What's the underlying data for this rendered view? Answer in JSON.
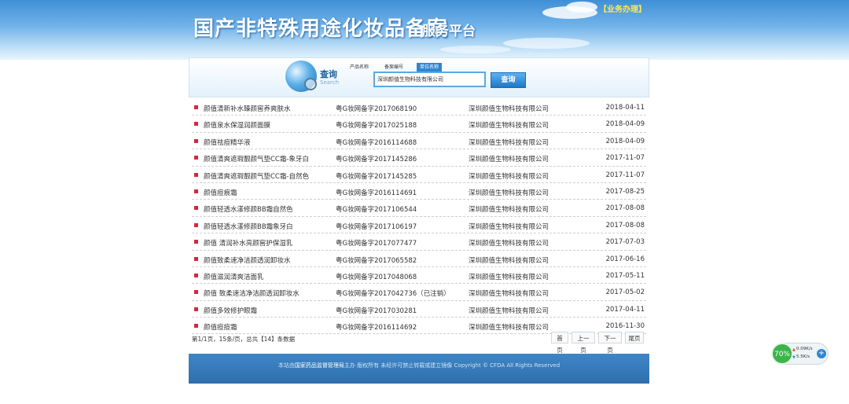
{
  "header": {
    "title": "国产非特殊用途化妆品备案",
    "subtitle": "服务平台",
    "service_link": "【业务办理】"
  },
  "search": {
    "label": "查询",
    "label_en": "Search",
    "tabs": [
      {
        "label": "产品名称",
        "active": false
      },
      {
        "label": "备案编号",
        "active": false
      },
      {
        "label": "单位名称",
        "active": true
      }
    ],
    "value": "深圳颜值生物科技有限公司",
    "button": "查询"
  },
  "rows": [
    {
      "name": "颜值清新补水臻颜窖养爽肤水",
      "reg": "粤G妆网备字2017068190",
      "company": "深圳颜值生物科技有限公司",
      "date": "2018-04-11"
    },
    {
      "name": "颜值泉水保湿润颜面膜",
      "reg": "粤G妆网备字2017025188",
      "company": "深圳颜值生物科技有限公司",
      "date": "2018-04-09"
    },
    {
      "name": "颜值祛痘精华液",
      "reg": "粤G妆网备字2016114688",
      "company": "深圳颜值生物科技有限公司",
      "date": "2018-04-09"
    },
    {
      "name": "颜值清爽遮瑕靓颜气垫CC霜-象牙白",
      "reg": "粤G妆网备字2017145286",
      "company": "深圳颜值生物科技有限公司",
      "date": "2017-11-07"
    },
    {
      "name": "颜值清爽遮瑕靓颜气垫CC霜-自然色",
      "reg": "粤G妆网备字2017145285",
      "company": "深圳颜值生物科技有限公司",
      "date": "2017-11-07"
    },
    {
      "name": "颜值痘痕霜",
      "reg": "粤G妆网备字2016114691",
      "company": "深圳颜值生物科技有限公司",
      "date": "2017-08-25"
    },
    {
      "name": "颜值轻透水漾修颜BB霜自然色",
      "reg": "粤G妆网备字2017106544",
      "company": "深圳颜值生物科技有限公司",
      "date": "2017-08-08"
    },
    {
      "name": "颜值轻透水漾修颜BB霜象牙白",
      "reg": "粤G妆网备字2017106197",
      "company": "深圳颜值生物科技有限公司",
      "date": "2017-08-08"
    },
    {
      "name": "颜值 清润补水亮颜窖护保湿乳",
      "reg": "粤G妆网备字2017077477",
      "company": "深圳颜值生物科技有限公司",
      "date": "2017-07-03"
    },
    {
      "name": "颜值致柔速净洁颜透润卸妆水",
      "reg": "粤G妆网备字2017065582",
      "company": "深圳颜值生物科技有限公司",
      "date": "2017-06-16"
    },
    {
      "name": "颜值滋润清爽洁面乳",
      "reg": "粤G妆网备字2017048068",
      "company": "深圳颜值生物科技有限公司",
      "date": "2017-05-11"
    },
    {
      "name": "颜值 致柔速洁净洁颜透润卸妆水",
      "reg": "粤G妆网备字2017042736（已注销）",
      "company": "深圳颜值生物科技有限公司",
      "date": "2017-05-02"
    },
    {
      "name": "颜值多效修护眼霜",
      "reg": "粤G妆网备字2017030281",
      "company": "深圳颜值生物科技有限公司",
      "date": "2017-04-11"
    },
    {
      "name": "颜值痘痘霜",
      "reg": "粤G妆网备字2016114692",
      "company": "深圳颜值生物科技有限公司",
      "date": "2016-11-30"
    }
  ],
  "pager": {
    "info": "第1/1页，15条/页，总共【14】条数据",
    "first": "首页",
    "prev": "上一页",
    "next": "下一页",
    "last": "尾页"
  },
  "footer": {
    "prefix": "本站由",
    "org": "国家药品监督管理局",
    "suffix": "主办 版权所有 未经许可禁止转载或建立镜像 Copyright © CFDA All Rights Reserved"
  },
  "speed": {
    "percent": "70%",
    "up": "0.09K/s",
    "down": "5.5K/s"
  },
  "colors": {
    "accent": "#2f86d0",
    "bullet": "#d7263d",
    "footer": "#2e6fae"
  }
}
